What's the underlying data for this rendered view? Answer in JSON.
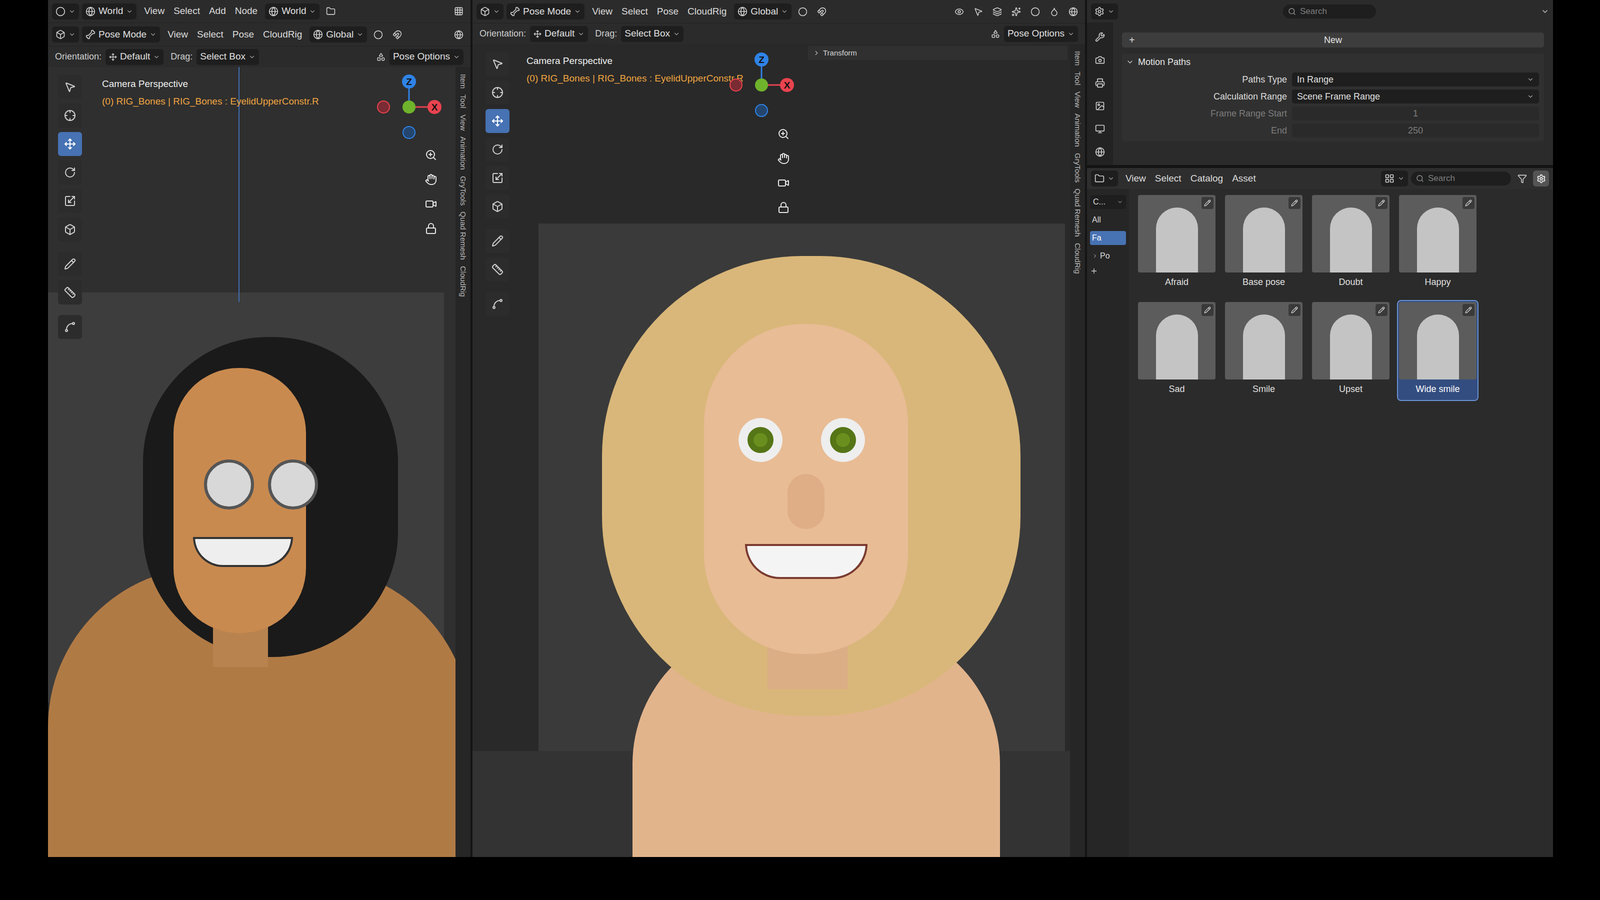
{
  "left_viewport": {
    "top_bar": {
      "scene": "World",
      "menus": [
        "View",
        "Select",
        "Add",
        "Node"
      ],
      "world": "World"
    },
    "header": {
      "mode": "Pose Mode",
      "menus": [
        "View",
        "Select",
        "Pose",
        "CloudRig"
      ],
      "transform": "Global"
    },
    "tool_settings": {
      "orientation_label": "Orientation:",
      "orientation": "Default",
      "drag_label": "Drag:",
      "drag": "Select Box",
      "options": "Pose Options"
    },
    "overlay_title": "Camera Perspective",
    "overlay_info": "(0) RIG_Bones | RIG_Bones : EyelidUpperConstr.R",
    "gizmo": {
      "z": "Z",
      "x": "X"
    },
    "tools": [
      {
        "selected": false
      },
      {
        "selected": false
      },
      {
        "selected": true
      },
      {
        "selected": false
      },
      {
        "selected": false
      },
      {
        "selected": false
      },
      {
        "selected": false
      },
      {
        "selected": false
      },
      {
        "selected": false
      }
    ],
    "side_tabs": [
      "Item",
      "Tool",
      "View",
      "Animation",
      "GryTools",
      "Quad Remesh",
      "CloudRig"
    ]
  },
  "center_viewport": {
    "header": {
      "mode": "Pose Mode",
      "menus": [
        "View",
        "Select",
        "Pose",
        "CloudRig"
      ],
      "transform": "Global"
    },
    "tool_settings": {
      "orientation_label": "Orientation:",
      "orientation": "Default",
      "drag_label": "Drag:",
      "drag": "Select Box",
      "options": "Pose Options"
    },
    "redo_panel": "Transform",
    "overlay_title": "Camera Perspective",
    "overlay_info": "(0) RIG_Bones | RIG_Bones : EyelidUpperConstr.R",
    "gizmo": {
      "z": "Z",
      "x": "X"
    },
    "tools": [
      {
        "selected": false
      },
      {
        "selected": false
      },
      {
        "selected": true
      },
      {
        "selected": false
      },
      {
        "selected": false
      },
      {
        "selected": false
      },
      {
        "selected": false
      },
      {
        "selected": false
      },
      {
        "selected": false
      }
    ],
    "side_tabs": [
      "Item",
      "Tool",
      "View",
      "Animation",
      "GryTools",
      "Quad Remesh",
      "CloudRig"
    ]
  },
  "properties": {
    "search_placeholder": "Search",
    "new_icon": "+",
    "new_button": "New",
    "panel": {
      "title": "Motion Paths",
      "expanded": true,
      "rows": [
        {
          "label": "Paths Type",
          "value": "In Range",
          "kind": "dropdown",
          "disabled": false
        },
        {
          "label": "Calculation Range",
          "value": "Scene Frame Range",
          "kind": "dropdown",
          "disabled": false
        },
        {
          "label": "Frame Range Start",
          "value": "1",
          "kind": "number",
          "disabled": true
        },
        {
          "label": "End",
          "value": "250",
          "kind": "number",
          "disabled": true
        }
      ]
    }
  },
  "asset_browser": {
    "menus": [
      "View",
      "Select",
      "Catalog",
      "Asset"
    ],
    "search_placeholder": "Search",
    "library": "C...",
    "catalogs": [
      {
        "label": "All",
        "selected": false,
        "expandable": false
      },
      {
        "label": "Fa",
        "selected": true,
        "expandable": false
      },
      {
        "label": "Po",
        "selected": false,
        "expandable": true
      }
    ],
    "assets": [
      {
        "name": "Afraid",
        "selected": false
      },
      {
        "name": "Base pose",
        "selected": false
      },
      {
        "name": "Doubt",
        "selected": false
      },
      {
        "name": "Happy",
        "selected": false
      },
      {
        "name": "Sad",
        "selected": false
      },
      {
        "name": "Smile",
        "selected": false
      },
      {
        "name": "Upset",
        "selected": false
      },
      {
        "name": "Wide smile",
        "selected": true
      }
    ]
  }
}
